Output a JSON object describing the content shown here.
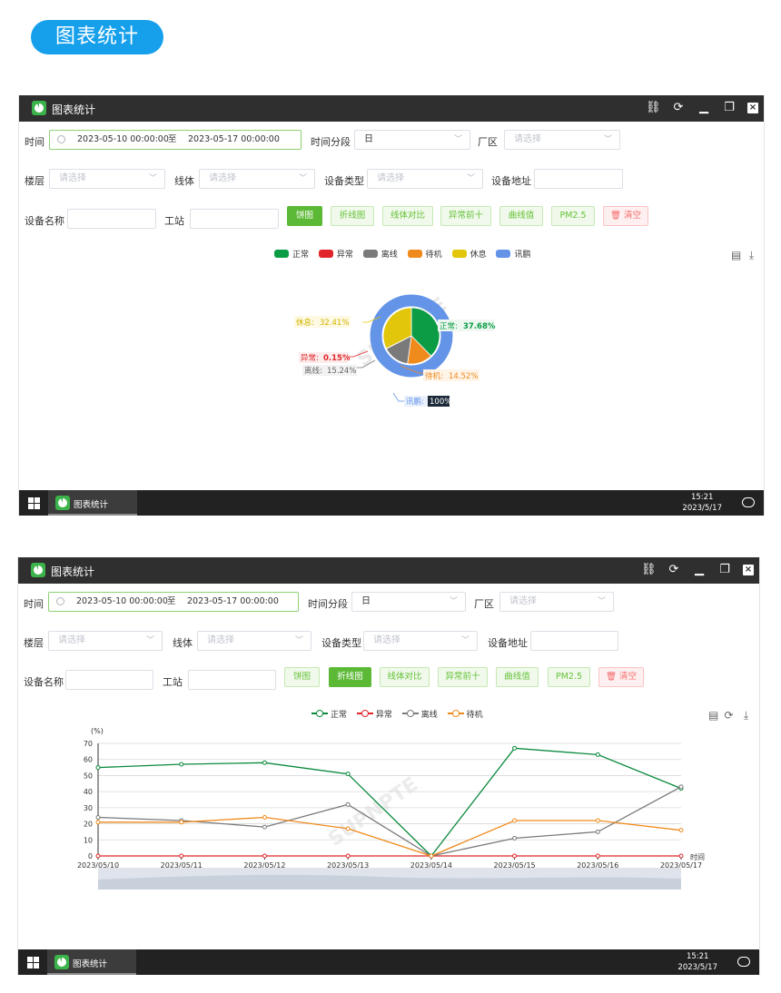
{
  "header": {
    "title": "图表统计"
  },
  "window": {
    "title": "图表统计",
    "controls": {
      "link": "⛓",
      "refresh": "⟳",
      "minimize": "▁",
      "restore": "❐",
      "close": "×"
    }
  },
  "filters": {
    "time_label": "时间",
    "date_start": "2023-05-10 00:00:00",
    "date_sep": "至",
    "date_end": "2023-05-17 00:00:00",
    "segment_label": "时间分段",
    "segment_value": "日",
    "plant_label": "厂区",
    "floor_label": "楼层",
    "line_label": "线体",
    "device_type_label": "设备类型",
    "device_addr_label": "设备地址",
    "device_name_label": "设备名称",
    "station_label": "工站",
    "placeholder": "请选择"
  },
  "buttons": {
    "pie": "饼图",
    "line": "折线图",
    "line_compare": "线体对比",
    "top10": "异常前十",
    "curve": "曲线值",
    "pm25": "PM2.5",
    "clear": "🗑 清空"
  },
  "watermark": "SUPNPTE",
  "pie_chart": {
    "type": "pie",
    "legend": [
      "正常",
      "异常",
      "离线",
      "待机",
      "休息",
      "讯鹏"
    ],
    "colors": {
      "正常": "#0b9c45",
      "异常": "#e0262b",
      "离线": "#7a7a7a",
      "待机": "#ef8a1c",
      "休息": "#e2c60c",
      "讯鹏": "#6394e8"
    },
    "inner": [
      {
        "name": "正常",
        "value": 37.68
      },
      {
        "name": "待机",
        "value": 14.52
      },
      {
        "name": "离线",
        "value": 15.24
      },
      {
        "name": "异常",
        "value": 0.15
      },
      {
        "name": "休息",
        "value": 32.41
      }
    ],
    "outer": [
      {
        "name": "讯鹏",
        "value": 100
      }
    ],
    "labels": {
      "normal": "正常:",
      "normal_pct": "37.68%",
      "standby": "待机:",
      "standby_pct": "14.52%",
      "offline": "离线:",
      "offline_pct": "15.24%",
      "abnormal": "异常:",
      "abnormal_pct": "0.15%",
      "rest": "休息:",
      "rest_pct": "32.41%",
      "xunpeng": "讯鹏:",
      "xunpeng_pct": "100%"
    }
  },
  "chart_data": {
    "type": "line",
    "categories": [
      "2023/05/10",
      "2023/05/11",
      "2023/05/12",
      "2023/05/13",
      "2023/05/14",
      "2023/05/15",
      "2023/05/16",
      "2023/05/17"
    ],
    "ylabel": "(%)",
    "xlabel": "时间",
    "ylim": [
      0,
      70
    ],
    "yticks": [
      "0",
      "10",
      "20",
      "30",
      "40",
      "50",
      "60",
      "70"
    ],
    "grid": true,
    "legend_position": "top",
    "series": [
      {
        "name": "正常",
        "color": "#0b8a3e",
        "values": [
          55,
          57,
          58,
          51,
          0,
          67,
          63,
          42
        ]
      },
      {
        "name": "异常",
        "color": "#e0262b",
        "values": [
          0,
          0,
          0,
          0,
          0,
          0,
          0,
          0
        ]
      },
      {
        "name": "离线",
        "color": "#7a7a7a",
        "values": [
          24,
          22,
          18,
          32,
          0,
          11,
          15,
          43
        ]
      },
      {
        "name": "待机",
        "color": "#ef8a1c",
        "values": [
          21,
          21,
          24,
          17,
          0,
          22,
          22,
          16
        ]
      }
    ]
  },
  "taskbar": {
    "app": "图表统计",
    "time": "15:21",
    "date": "2023/5/17"
  }
}
